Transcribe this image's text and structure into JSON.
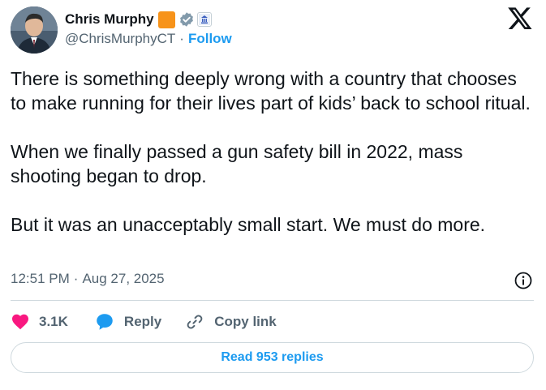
{
  "author": {
    "name": "Chris Murphy",
    "handle": "@ChrisMurphyCT",
    "separator": "·",
    "follow_label": "Follow",
    "avatar_icon": "user-portrait-icon",
    "badges": [
      "orange-square-badge",
      "verified-badge-icon",
      "government-affiliation-icon"
    ]
  },
  "platform_icon": "x-logo-icon",
  "tweet": {
    "paragraphs": [
      "There is something deeply wrong with a country that chooses to make running for their lives part of kids’ back to school ritual.",
      "When we finally passed a gun safety bill in 2022, mass shooting began to drop.",
      "But it was an unacceptably small start. We must do more."
    ],
    "time": "12:51 PM",
    "date_separator": "·",
    "date": "Aug 27, 2025"
  },
  "actions": {
    "like_count": "3.1K",
    "reply_label": "Reply",
    "copy_link_label": "Copy link"
  },
  "read_replies_label": "Read 953 replies",
  "colors": {
    "accent": "#1d9bf0",
    "like": "#f91880",
    "text": "#0f1419",
    "secondary_text": "#536471",
    "badge_orange": "#f7931a",
    "border": "#cfd9de"
  }
}
